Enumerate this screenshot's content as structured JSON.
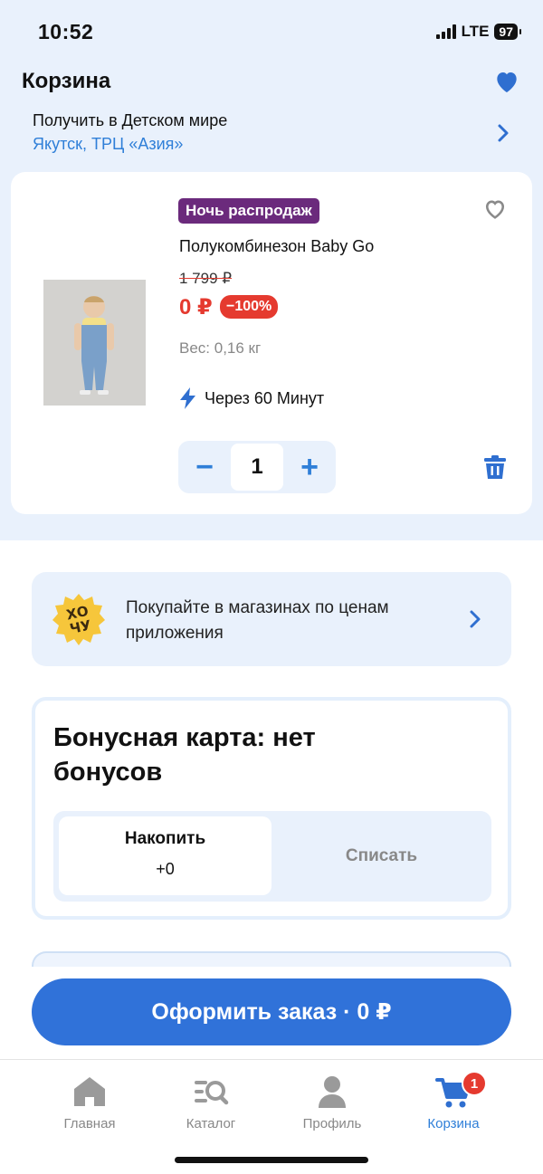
{
  "status_bar": {
    "time": "10:52",
    "network": "LTE",
    "battery": "97"
  },
  "header": {
    "title": "Корзина",
    "favorites_icon": "heart-icon"
  },
  "pickup": {
    "label": "Получить в Детском мире",
    "address": "Якутск, ТРЦ «Азия»"
  },
  "cart_item": {
    "badge": "Ночь распродаж",
    "name": "Полукомбинезон Baby Go",
    "old_price": "1 799 ₽",
    "price": "0 ₽",
    "discount": "−100%",
    "weight": "Вес: 0,16 кг",
    "delivery": "Через 60 Минут",
    "quantity": "1",
    "minus": "−",
    "plus": "+"
  },
  "promo": {
    "text": "Покупайте в магазинах по ценам приложения",
    "logo_text": "ХОЧУ"
  },
  "bonus": {
    "title": "Бонусная карта: нет бонусов",
    "accumulate_label": "Накопить",
    "accumulate_value": "+0",
    "spend_label": "Списать"
  },
  "order_button": "Оформить заказ · 0 ₽",
  "tabs": [
    {
      "label": "Главная",
      "icon": "home-icon"
    },
    {
      "label": "Каталог",
      "icon": "catalog-search-icon"
    },
    {
      "label": "Профиль",
      "icon": "profile-icon"
    },
    {
      "label": "Корзина",
      "icon": "cart-icon",
      "badge": "1",
      "active": true
    }
  ],
  "colors": {
    "accent": "#3072d9",
    "sale": "#e53a2f",
    "badge_purple": "#6b2a7c",
    "background_tint": "#e9f1fc"
  }
}
